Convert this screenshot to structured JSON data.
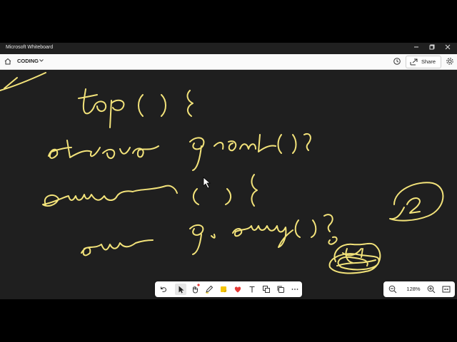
{
  "window": {
    "title": "Microsoft Whiteboard",
    "controls": [
      "minimize",
      "maximize",
      "close"
    ]
  },
  "appbar": {
    "board_name": "CODING",
    "share_label": "Share"
  },
  "canvas": {
    "background": "#1f1f1f",
    "ink_color": "#f3e37a",
    "handwritten_lines": [
      "top() {",
      "return q.front();",
      "empty() {",
      "return q.empty();"
    ],
    "annotations": [
      "2"
    ]
  },
  "toolbar": {
    "tools": [
      "undo",
      "select",
      "hand",
      "pen",
      "highlighter",
      "reactions",
      "text",
      "shapes",
      "templates",
      "more"
    ]
  },
  "zoom": {
    "value": "128%"
  }
}
